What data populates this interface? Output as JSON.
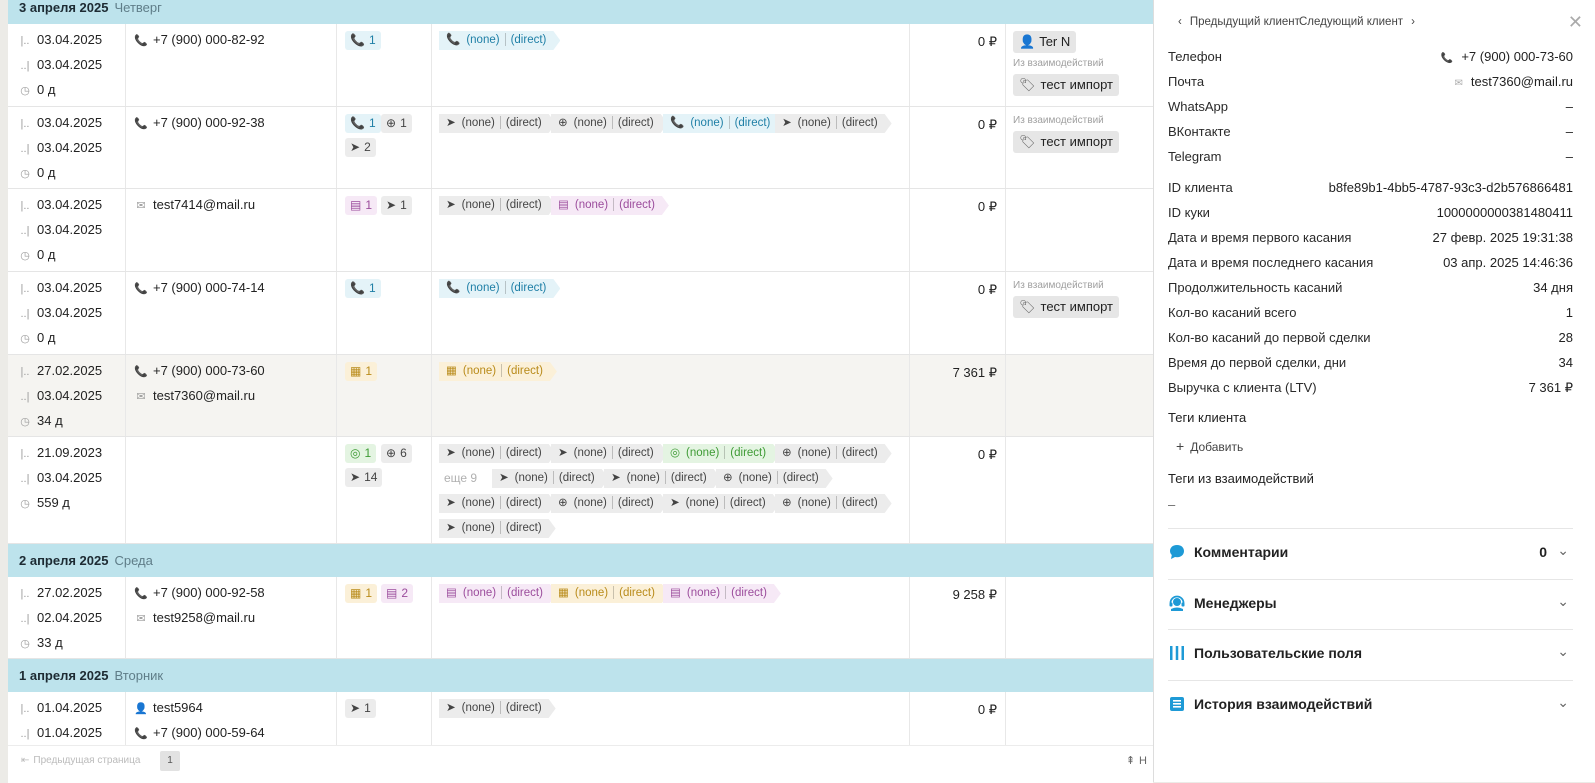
{
  "groups": [
    {
      "date": "3 апреля 2025",
      "weekday": "Четверг"
    },
    {
      "date": "2 апреля 2025",
      "weekday": "Среда"
    },
    {
      "date": "1 апреля 2025",
      "weekday": "Вторник"
    }
  ],
  "rows": [
    {
      "d1": "03.04.2025",
      "d2": "03.04.2025",
      "dur": "0 д",
      "contacts": [
        "+7 (900) 000-82-92"
      ],
      "badges": [
        {
          "icon": "📞",
          "n": "1"
        }
      ],
      "chips": [
        {
          "icon": "📞",
          "a": "(none)",
          "b": "(direct)"
        }
      ],
      "money": "0 ₽",
      "manager": "Ter N",
      "tag_note": "Из взаимодействий",
      "tag": "тест импорт"
    },
    {
      "d1": "03.04.2025",
      "d2": "03.04.2025",
      "dur": "0 д",
      "contacts": [
        "+7 (900) 000-92-38"
      ],
      "badges": [
        {
          "icon": "📞",
          "n": "1"
        },
        {
          "icon": "⊕",
          "n": "1"
        },
        {
          "icon": "➤",
          "n": "2"
        }
      ],
      "chips": [
        {
          "icon": "➤",
          "a": "(none)",
          "b": "(direct)"
        },
        {
          "icon": "⊕",
          "a": "(none)",
          "b": "(direct)"
        },
        {
          "icon": "📞",
          "a": "(none)",
          "b": "(direct)"
        },
        {
          "icon": "➤",
          "a": "(none)",
          "b": "(direct)"
        }
      ],
      "money": "0 ₽",
      "tag_note": "Из взаимодействий",
      "tag": "тест импорт"
    },
    {
      "d1": "03.04.2025",
      "d2": "03.04.2025",
      "dur": "0 д",
      "contacts": [
        "test7414@mail.ru"
      ],
      "badges": [
        {
          "icon": "▤",
          "n": "1"
        },
        {
          "icon": "➤",
          "n": "1"
        }
      ],
      "chips": [
        {
          "icon": "➤",
          "a": "(none)",
          "b": "(direct)"
        },
        {
          "icon": "▤",
          "a": "(none)",
          "b": "(direct)"
        }
      ],
      "money": "0 ₽"
    },
    {
      "d1": "03.04.2025",
      "d2": "03.04.2025",
      "dur": "0 д",
      "contacts": [
        "+7 (900) 000-74-14"
      ],
      "badges": [
        {
          "icon": "📞",
          "n": "1"
        }
      ],
      "chips": [
        {
          "icon": "📞",
          "a": "(none)",
          "b": "(direct)"
        }
      ],
      "money": "0 ₽",
      "tag_note": "Из взаимодействий",
      "tag": "тест импорт"
    },
    {
      "d1": "27.02.2025",
      "d2": "03.04.2025",
      "dur": "34 д",
      "contacts": [
        "+7 (900) 000-73-60",
        "test7360@mail.ru"
      ],
      "badges": [
        {
          "icon": "▦",
          "n": "1"
        }
      ],
      "chips": [
        {
          "icon": "▦",
          "a": "(none)",
          "b": "(direct)"
        }
      ],
      "money": "7 361 ₽"
    },
    {
      "d1": "21.09.2023",
      "d2": "03.04.2025",
      "dur": "559 д",
      "contacts": [],
      "badges": [
        {
          "icon": "◎",
          "n": "1"
        },
        {
          "icon": "⊕",
          "n": "6"
        },
        {
          "icon": "➤",
          "n": "14"
        }
      ],
      "more": "еще 9",
      "chips": [
        {
          "icon": "➤",
          "a": "(none)",
          "b": "(direct)"
        },
        {
          "icon": "➤",
          "a": "(none)",
          "b": "(direct)"
        },
        {
          "icon": "◎",
          "a": "(none)",
          "b": "(direct)"
        },
        {
          "icon": "⊕",
          "a": "(none)",
          "b": "(direct)"
        },
        {
          "icon": "➤",
          "a": "(none)",
          "b": "(direct)"
        },
        {
          "icon": "➤",
          "a": "(none)",
          "b": "(direct)"
        },
        {
          "icon": "⊕",
          "a": "(none)",
          "b": "(direct)"
        },
        {
          "icon": "➤",
          "a": "(none)",
          "b": "(direct)"
        },
        {
          "icon": "⊕",
          "a": "(none)",
          "b": "(direct)"
        },
        {
          "icon": "➤",
          "a": "(none)",
          "b": "(direct)"
        },
        {
          "icon": "⊕",
          "a": "(none)",
          "b": "(direct)"
        },
        {
          "icon": "➤",
          "a": "(none)",
          "b": "(direct)"
        }
      ],
      "money": "0 ₽"
    },
    {
      "d1": "27.02.2025",
      "d2": "02.04.2025",
      "dur": "33 д",
      "contacts": [
        "+7 (900) 000-92-58",
        "test9258@mail.ru"
      ],
      "badges": [
        {
          "icon": "▦",
          "n": "1"
        },
        {
          "icon": "▤",
          "n": "2"
        }
      ],
      "chips": [
        {
          "icon": "▤",
          "a": "(none)",
          "b": "(direct)"
        },
        {
          "icon": "▦",
          "a": "(none)",
          "b": "(direct)"
        },
        {
          "icon": "▤",
          "a": "(none)",
          "b": "(direct)"
        }
      ],
      "money": "9 258 ₽"
    },
    {
      "d1": "01.04.2025",
      "d2": "01.04.2025",
      "dur": "",
      "contacts": [
        "test5964",
        "+7 (900) 000-59-64"
      ],
      "badges": [
        {
          "icon": "➤",
          "n": "1"
        }
      ],
      "chips": [
        {
          "icon": "➤",
          "a": "(none)",
          "b": "(direct)"
        }
      ],
      "money": "0 ₽"
    }
  ],
  "pager": {
    "prev": "Предыдущая страница",
    "page": "1",
    "up": "Н"
  },
  "panel": {
    "prev": "Предыдущий клиент",
    "next": "Следующий клиент",
    "contacts": [
      {
        "k": "Телефон",
        "v": "+7 (900) 000-73-60"
      },
      {
        "k": "Почта",
        "v": "test7360@mail.ru"
      },
      {
        "k": "WhatsApp",
        "v": "–"
      },
      {
        "k": "ВКонтакте",
        "v": "–"
      },
      {
        "k": "Telegram",
        "v": "–"
      }
    ],
    "stats": [
      {
        "k": "ID клиента",
        "v": "b8fe89b1-4bb5-4787-93c3-d2b576866481"
      },
      {
        "k": "ID куки",
        "v": "1000000000381480411"
      },
      {
        "k": "Дата и время первого касания",
        "v": "27 февр. 2025 19:31:38"
      },
      {
        "k": "Дата и время последнего касания",
        "v": "03 апр. 2025 14:46:36"
      },
      {
        "k": "Продолжительность касаний",
        "v": "34 дня"
      },
      {
        "k": "Кол-во касаний всего",
        "v": "1"
      },
      {
        "k": "Кол-во касаний до первой сделки",
        "v": "28"
      },
      {
        "k": "Время до первой сделки, дни",
        "v": "34"
      },
      {
        "k": "Выручка с клиента (LTV)",
        "v": "7 361 ₽"
      }
    ],
    "tags_title": "Теги клиента",
    "add": "Добавить",
    "itags_title": "Теги из взаимодействий",
    "itags_value": "–",
    "sections": [
      {
        "title": "Комментарии",
        "count": "0",
        "icon": "comment-icon"
      },
      {
        "title": "Менеджеры",
        "icon": "headset-icon"
      },
      {
        "title": "Пользовательские поля",
        "icon": "columns-icon"
      },
      {
        "title": "История взаимодействий",
        "icon": "inbox-icon"
      }
    ]
  },
  "colors": {
    "header": "#bde3ec",
    "accent": "#1e9ad6"
  }
}
